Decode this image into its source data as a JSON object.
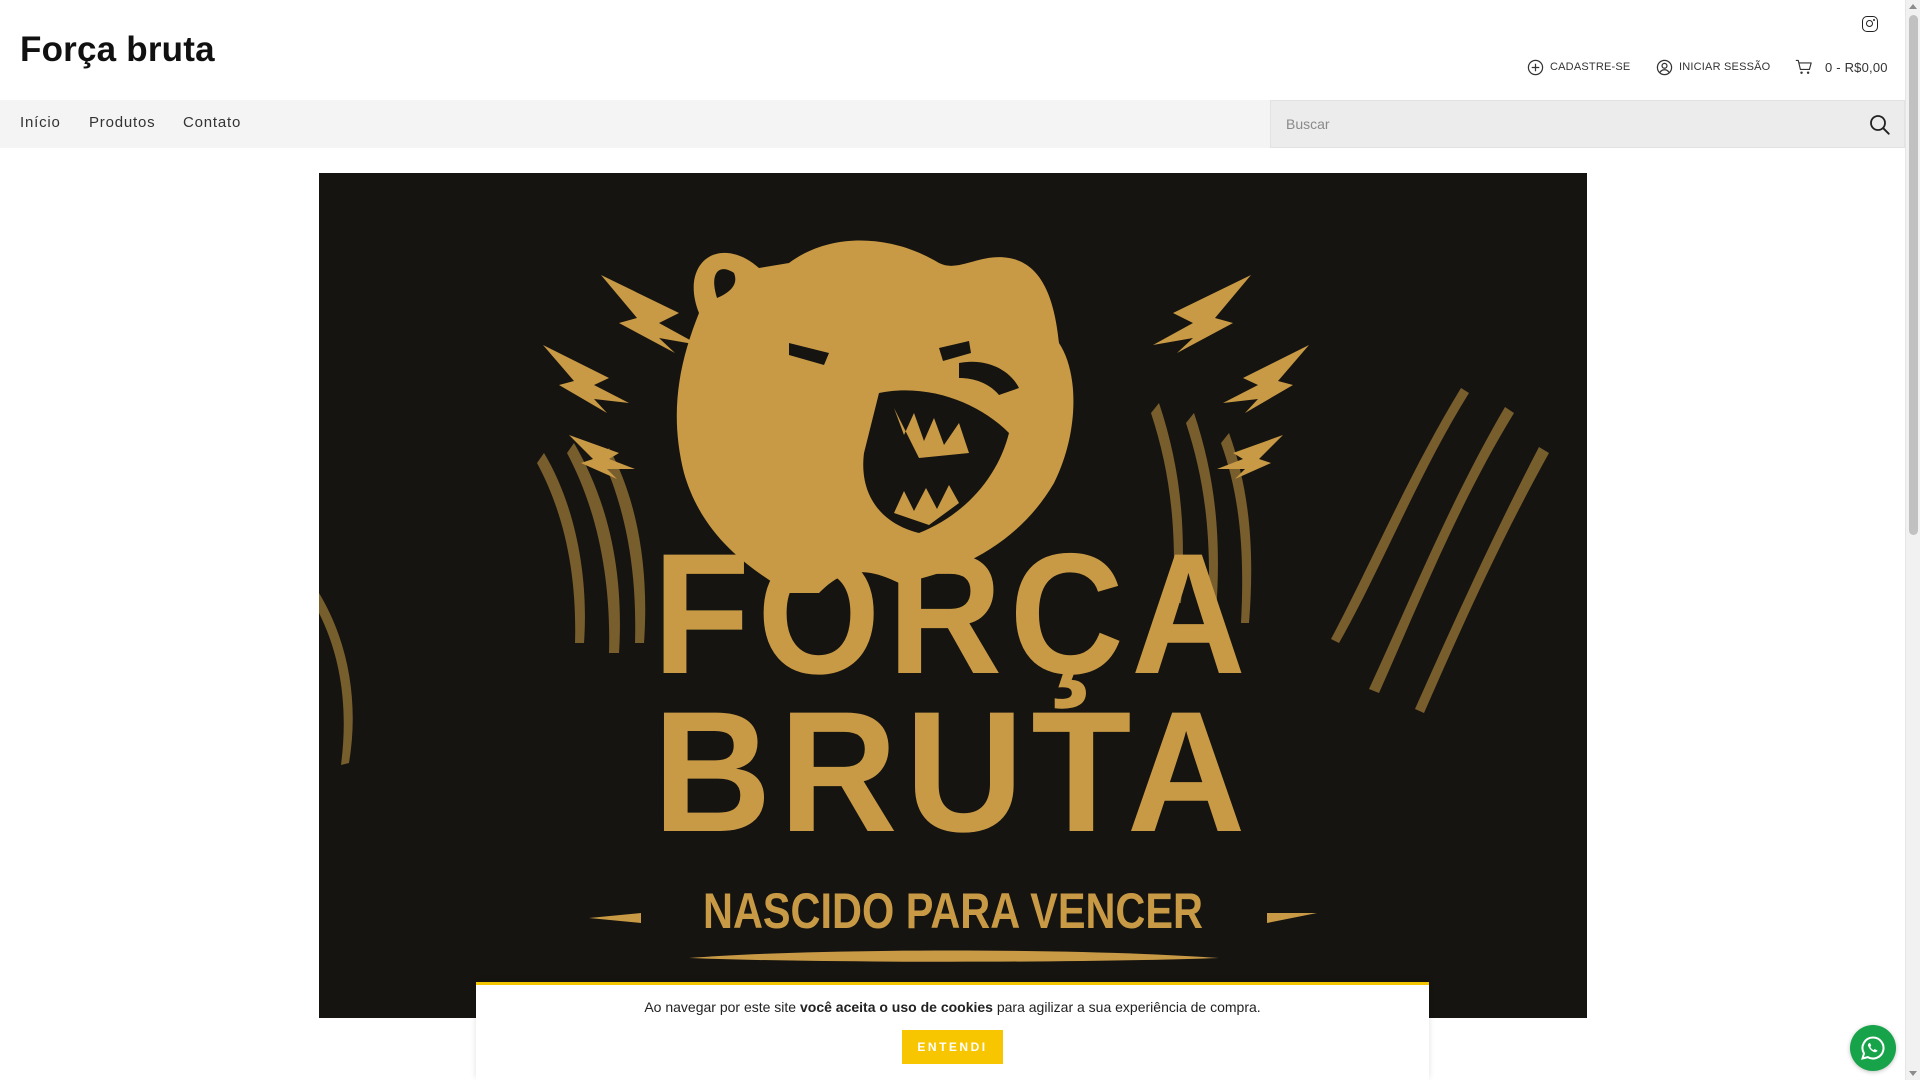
{
  "header": {
    "store_name": "Força bruta",
    "social": {
      "icon": "instagram-icon"
    },
    "account": {
      "register_label": "CADASTRE-SE",
      "register_icon": "plus-circle-icon",
      "login_label": "INICIAR SESSÃO",
      "login_icon": "user-icon",
      "cart_label": "0 - R$0,00",
      "cart_icon": "cart-icon"
    }
  },
  "nav": {
    "items": [
      {
        "label": "Início"
      },
      {
        "label": "Produtos"
      },
      {
        "label": "Contato"
      }
    ],
    "search": {
      "placeholder": "Buscar",
      "value": "",
      "icon": "search-icon"
    }
  },
  "banner": {
    "line1": "FORÇA",
    "line2": "BRUTA",
    "tagline": "NASCIDO PARA VENCER",
    "colors": {
      "background": "#161410",
      "gold": "#c99a45"
    },
    "icons": [
      "bear-head-icon",
      "lightning-bolt-icon",
      "claw-marks-icon"
    ]
  },
  "cookie_bar": {
    "text_before": "Ao navegar por este site ",
    "text_bold": "você aceita o uso de cookies",
    "text_after": " para agilizar a sua experiência de compra.",
    "button_label": "ENTENDI",
    "colors": {
      "accent": "#f7c600"
    }
  },
  "floating": {
    "whatsapp_icon": "whatsapp-icon",
    "color": "#16a34a"
  }
}
